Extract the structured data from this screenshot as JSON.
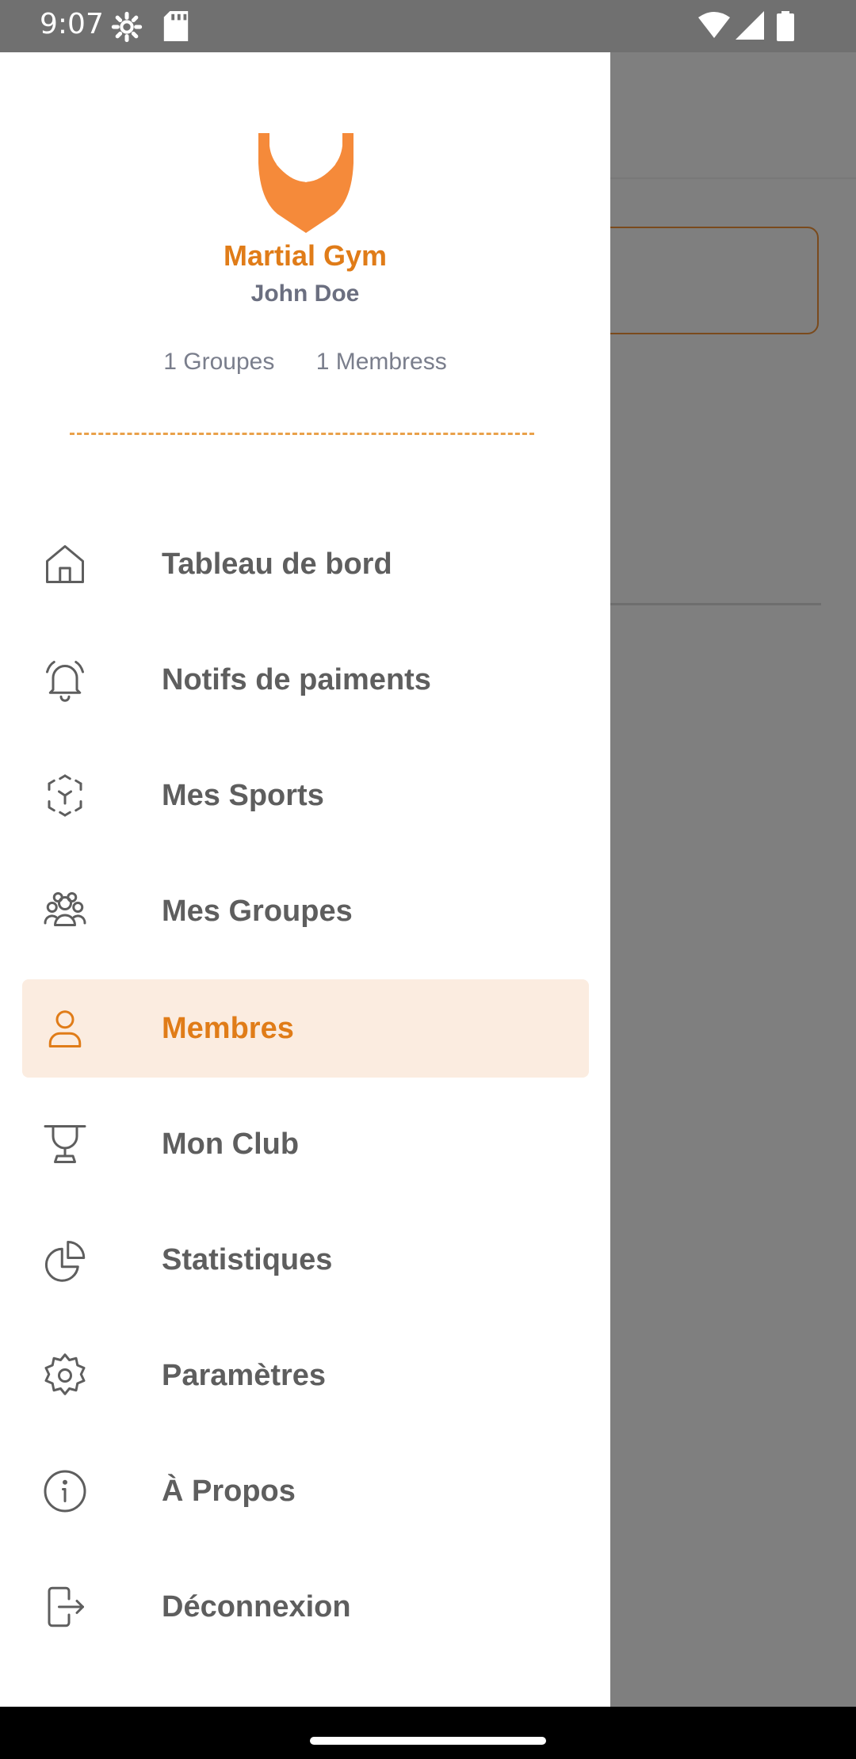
{
  "status_bar": {
    "time": "9:07",
    "icons": [
      "settings-icon",
      "sd-card-icon",
      "wifi-icon",
      "cellular-signal-icon",
      "battery-icon"
    ]
  },
  "drawer": {
    "logo": "martial-gym-logo",
    "club_name": "Martial Gym",
    "user_name": "John Doe",
    "stats": {
      "groups": "1 Groupes",
      "members": "1 Membress"
    },
    "accent_color": "#e07c18",
    "active_bg_color": "#fbece0",
    "menu": [
      {
        "label": "Tableau de bord",
        "icon": "home-icon"
      },
      {
        "label": "Notifs de paiments",
        "icon": "bell-icon"
      },
      {
        "label": "Mes Sports",
        "icon": "sports-icon"
      },
      {
        "label": "Mes Groupes",
        "icon": "groups-icon"
      },
      {
        "label": "Membres",
        "icon": "user-icon",
        "active": true
      },
      {
        "label": "Mon Club",
        "icon": "trophy-icon"
      },
      {
        "label": "Statistiques",
        "icon": "pie-chart-icon"
      },
      {
        "label": "Paramètres",
        "icon": "gear-icon"
      },
      {
        "label": "À Propos",
        "icon": "info-icon"
      },
      {
        "label": "Déconnexion",
        "icon": "logout-icon"
      }
    ]
  },
  "nav_bar": {
    "handle": "home-indicator"
  }
}
